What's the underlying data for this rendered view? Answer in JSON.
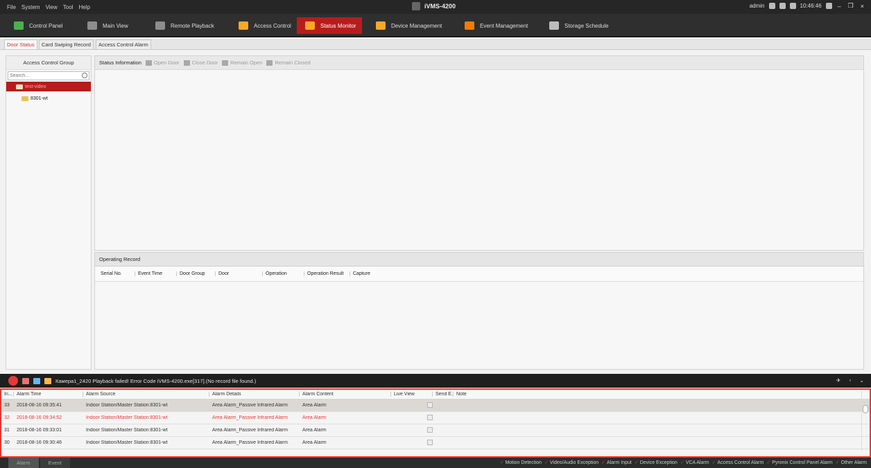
{
  "menu": [
    "File",
    "System",
    "View",
    "Tool",
    "Help"
  ],
  "app_title": "iVMS-4200",
  "tray": {
    "user": "admin",
    "time": "10:46:46"
  },
  "toolbar": {
    "items": [
      {
        "label": "Control Panel",
        "color": "#4caf50"
      },
      {
        "label": "Main View",
        "color": "#8d8d8d"
      },
      {
        "label": "Remote Playback",
        "color": "#8d8d8d"
      },
      {
        "label": "Access Control",
        "color": "#f9a825"
      },
      {
        "label": "Status Monitor",
        "color": "#f9a825"
      },
      {
        "label": "Device Management",
        "color": "#f9a825"
      },
      {
        "label": "Event Management",
        "color": "#f57c00"
      },
      {
        "label": "Storage Schedule",
        "color": "#bdbdbd"
      }
    ]
  },
  "subtabs": [
    "Door Status",
    "Card Swiping Record",
    "Access Control Alarm"
  ],
  "left": {
    "title": "Access Control Group",
    "search_placeholder": "Search...",
    "tree": [
      {
        "label": "test-video"
      },
      {
        "label": "8301-wt"
      }
    ]
  },
  "status": {
    "label": "Status Information",
    "buttons": [
      "Open Door",
      "Close Door",
      "Remain Open",
      "Remain Closed"
    ]
  },
  "operating": {
    "title": "Operating Record",
    "columns": [
      "Serial No.",
      "Event Time",
      "Door Group",
      "Door",
      "Operation",
      "Operation Result",
      "Capture"
    ]
  },
  "alarm_message": "Камера1_2420 Playback failed! Error Code iVMS-4200.exe[317].(No record file found.)",
  "alarm_table": {
    "columns": [
      "In...",
      "Alarm Time",
      "Alarm Source",
      "Alarm Details",
      "Alarm Content",
      "Live View",
      "Send E...",
      "Note"
    ],
    "rows": [
      {
        "idx": "33",
        "time": "2018-08-16 09:35:41",
        "source": "Indoor Station/Master Station:8301-wt",
        "details": "Area Alarm_Passive Infrared Alarm",
        "content": "Area Alarm"
      },
      {
        "idx": "32",
        "time": "2018-08-16 09:34:52",
        "source": "Indoor Station/Master Station:8301-wt",
        "details": "Area Alarm_Passive Infrared Alarm",
        "content": "Area Alarm"
      },
      {
        "idx": "31",
        "time": "2018-08-16 09:33:01",
        "source": "Indoor Station/Master Station:8301-wt",
        "details": "Area Alarm_Passive Infrared Alarm",
        "content": "Area Alarm"
      },
      {
        "idx": "30",
        "time": "2018-08-16 09:30:46",
        "source": "Indoor Station/Master Station:8301-wt",
        "details": "Area Alarm_Passive Infrared Alarm",
        "content": "Area Alarm"
      }
    ]
  },
  "bottom_tabs": [
    "Alarm",
    "Event"
  ],
  "filters": [
    "Motion Detection",
    "Video/Audio Exception",
    "Alarm Input",
    "Device Exception",
    "VCA Alarm",
    "Access Control Alarm",
    "Pyronix Control Panel Alarm",
    "Other Alarm"
  ]
}
